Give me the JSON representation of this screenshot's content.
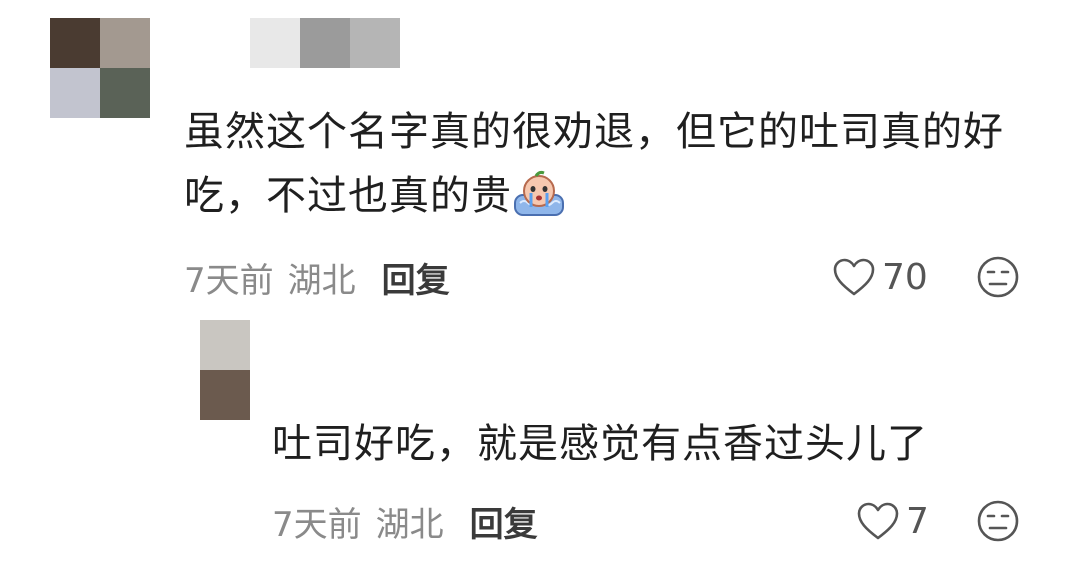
{
  "main_comment": {
    "avatar_colors": [
      "#4a3b31",
      "#a39990",
      "#c2c4cf",
      "#5a6257"
    ],
    "username_blur_colors": [
      "#e8e8e8",
      "#9b9b9b",
      "#b5b5b5"
    ],
    "text": "虽然这个名字真的很劝退，但它的吐司真的好吃，不过也真的贵",
    "emoji": "crying-emoji",
    "time": "7天前",
    "location": "湖北",
    "reply_label": "回复",
    "like_count": "70"
  },
  "reply_comment": {
    "avatar_colors": [
      "#c9c6c1",
      "#6b5a4e"
    ],
    "text": "吐司好吃，就是感觉有点香过头儿了",
    "time": "7天前",
    "location": "湖北",
    "reply_label": "回复",
    "like_count": "7"
  },
  "icons": {
    "like": "heart-outline-icon",
    "dislike": "neutral-face-icon"
  }
}
